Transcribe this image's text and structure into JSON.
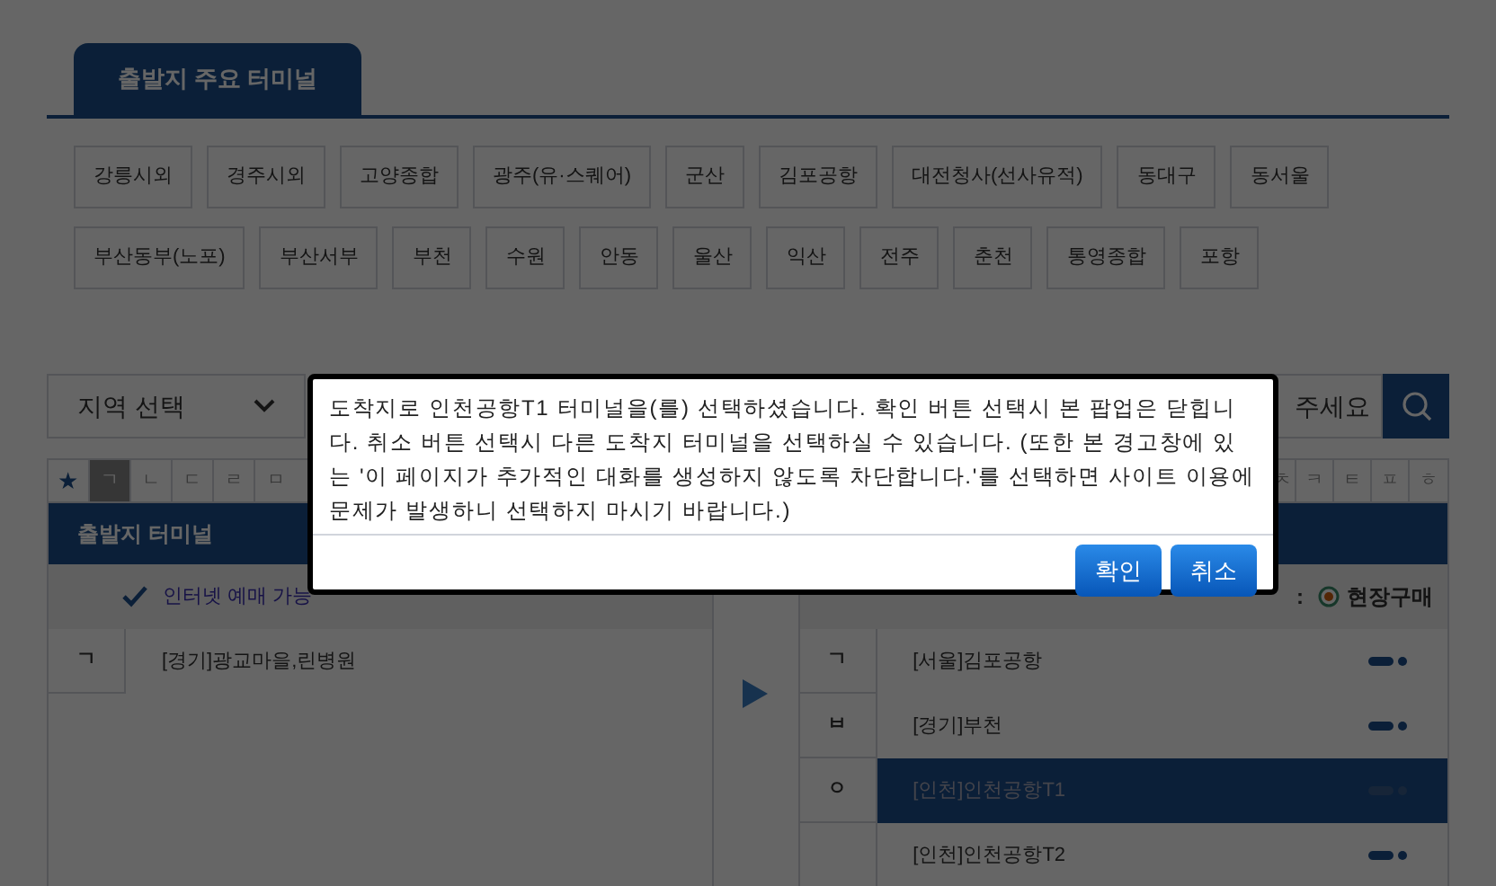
{
  "tabs": [
    {
      "label": "출발지 주요 터미널",
      "selected": true
    }
  ],
  "terminal_buttons": [
    [
      "강릉시외",
      "경주시외",
      "고양종합",
      "광주(유·스퀘어)",
      "군산",
      "김포공항",
      "대전청사(선사유적)",
      "동대구",
      "동서울"
    ],
    [
      "부산동부(노포)",
      "부산서부",
      "부천",
      "수원",
      "안동",
      "울산",
      "익산",
      "전주",
      "춘천",
      "통영종합",
      "포항"
    ]
  ],
  "region_select": {
    "value": "지역 선택"
  },
  "search": {
    "placeholder": "주세요"
  },
  "index_left": [
    {
      "label": "★",
      "selected": false
    },
    {
      "label": "ㄱ",
      "selected": true
    },
    {
      "label": "ㄴ",
      "selected": false
    },
    {
      "label": "ㄷ",
      "selected": false
    },
    {
      "label": "ㄹ",
      "selected": false
    },
    {
      "label": "ㅁ",
      "selected": false
    }
  ],
  "index_right": [
    {
      "label": "ㅊ",
      "selected": false
    },
    {
      "label": "ㅋ",
      "selected": false
    },
    {
      "label": "ㅌ",
      "selected": false
    },
    {
      "label": "ㅍ",
      "selected": false
    },
    {
      "label": "ㅎ",
      "selected": false
    }
  ],
  "departure": {
    "title": "출발지 터미널",
    "filter": {
      "label": "인터넷 예매 가능",
      "checked": true
    },
    "groups": [
      {
        "letter": "ㄱ",
        "items": [
          "[경기]광교마을,린병원"
        ]
      }
    ]
  },
  "arrival": {
    "legend_label": ":",
    "legend_option": {
      "label": "현장구매",
      "selected": true
    },
    "rows": [
      {
        "letter": "ㄱ",
        "name": "[서울]김포공항",
        "selected": false
      },
      {
        "letter": "ㅂ",
        "name": "[경기]부천",
        "selected": false
      },
      {
        "letter": "ㅇ",
        "name": "[인천]인천공항T1",
        "selected": true
      },
      {
        "name": "[인천]인천공항T2",
        "selected": false
      }
    ]
  },
  "dialog": {
    "message": "도착지로 인천공항T1 터미널을(를) 선택하셨습니다. 확인 버튼 선택시 본 팝업은 닫힙니다. 취소 버튼 선택시 다른 도착지 터미널을 선택하실 수 있습니다. (또한 본 경고창에 있는 '이 페이지가 추가적인 대화를 생성하지 않도록 차단합니다.'를 선택하면 사이트 이용에 문제가 발생하니 선택하지 마시기 바랍니다.)",
    "buttons": [
      "확인",
      "취소"
    ]
  }
}
